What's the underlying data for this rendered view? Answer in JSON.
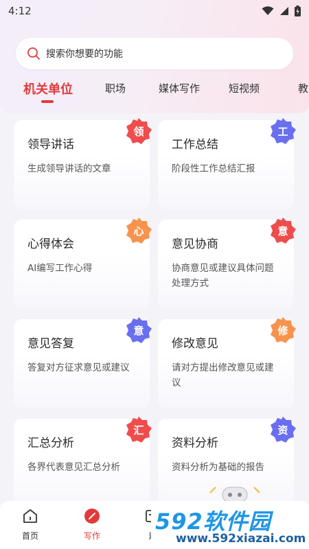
{
  "status_bar": {
    "time": "4:12"
  },
  "search": {
    "placeholder": "搜索你想要的功能"
  },
  "tabs": [
    {
      "label": "机关单位",
      "active": true
    },
    {
      "label": "职场"
    },
    {
      "label": "媒体写作"
    },
    {
      "label": "短视频"
    },
    {
      "label": "教"
    }
  ],
  "cards": [
    {
      "title": "领导讲话",
      "desc": "生成领导讲话的文章",
      "badge": "领",
      "badge_color": "#ef4d4d"
    },
    {
      "title": "工作总结",
      "desc": "阶段性工作总结汇报",
      "badge": "工",
      "badge_color": "#6a6ff0"
    },
    {
      "title": "心得体会",
      "desc": "AI编写工作心得",
      "badge": "心",
      "badge_color": "#f7934d"
    },
    {
      "title": "意见协商",
      "desc": "协商意见或建议具体问题处理方式",
      "badge": "意",
      "badge_color": "#ef4d4d"
    },
    {
      "title": "意见答复",
      "desc": "答复对方征求意见或建议",
      "badge": "意",
      "badge_color": "#6a6ff0"
    },
    {
      "title": "修改意见",
      "desc": "请对方提出修改意见或建议",
      "badge": "修",
      "badge_color": "#f7934d"
    },
    {
      "title": "汇总分析",
      "desc": "各界代表意见汇总分析",
      "badge": "汇",
      "badge_color": "#ef4d4d"
    },
    {
      "title": "资料分析",
      "desc": "资料分析为基础的报告",
      "badge": "资",
      "badge_color": "#6a6ff0"
    }
  ],
  "bottom_nav": [
    {
      "label": "首页",
      "icon": "home-icon"
    },
    {
      "label": "写作",
      "icon": "pen-icon",
      "active": true
    },
    {
      "label": "素",
      "icon": "material-icon"
    }
  ],
  "watermark": {
    "brand": "592软件园",
    "url": "www.592xiazai.com"
  },
  "colors": {
    "accent": "#e23a3a",
    "watermark_blue": "#1e96e6"
  }
}
